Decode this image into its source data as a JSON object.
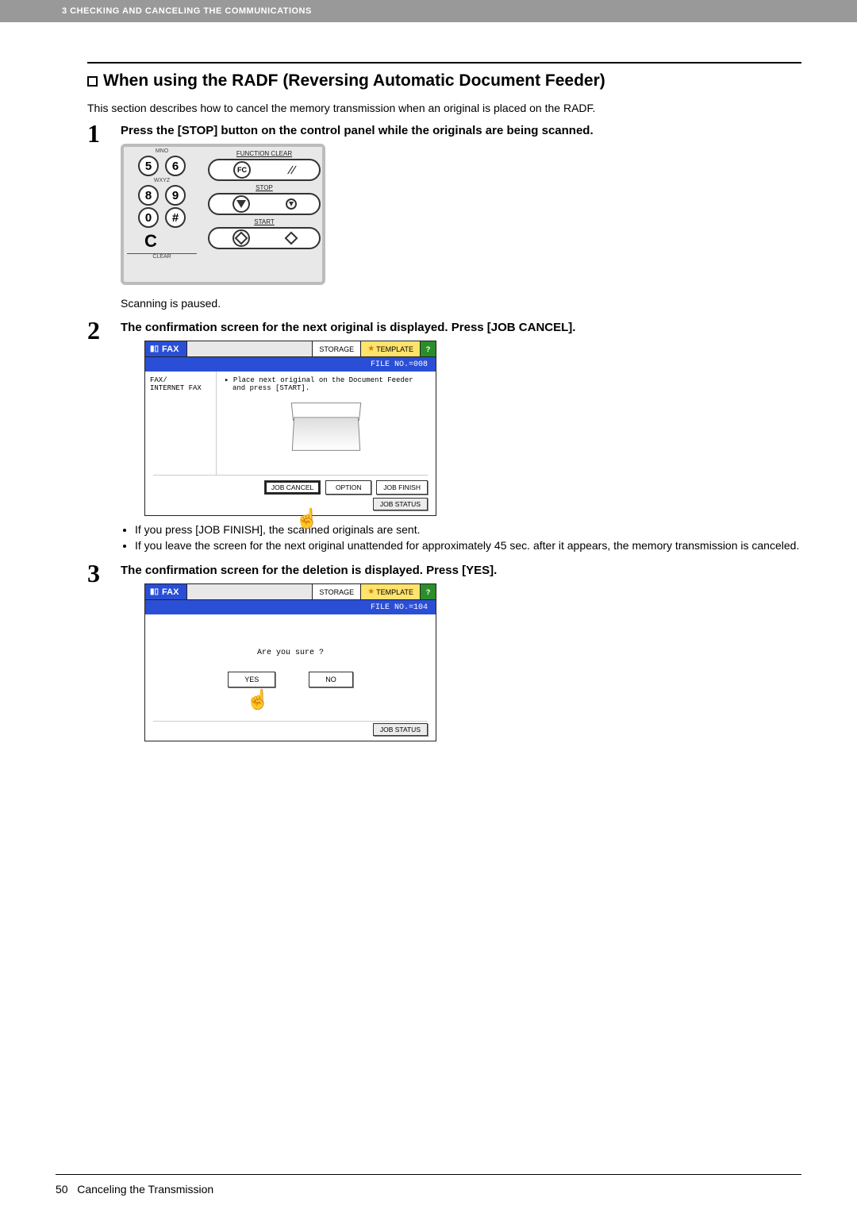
{
  "header": {
    "chapter": "3 CHECKING AND CANCELING THE COMMUNICATIONS"
  },
  "section": {
    "title": "When using the RADF (Reversing Automatic Document Feeder)",
    "intro": "This section describes how to cancel the memory transmission when an original is placed on the RADF."
  },
  "steps": {
    "s1": {
      "num": "1",
      "heading": "Press the [STOP] button on the control panel while the originals are being scanned.",
      "panel": {
        "mno": "MNO",
        "wxyz": "WXYZ",
        "clear": "CLEAR",
        "k5": "5",
        "k6": "6",
        "k8": "8",
        "k9": "9",
        "k0": "0",
        "kh": "#",
        "kc": "C",
        "func_clear": "FUNCTION CLEAR",
        "fc": "FC",
        "stop": "STOP",
        "start": "START"
      },
      "note": "Scanning is paused."
    },
    "s2": {
      "num": "2",
      "heading": "The confirmation screen for the next original is displayed. Press [JOB CANCEL].",
      "lcd": {
        "fax": "FAX",
        "storage": "STORAGE",
        "template": "TEMPLATE",
        "help": "?",
        "file": "FILE NO.=008",
        "side": "FAX/\nINTERNET FAX",
        "msg1": "▸ Place next original on the Document Feeder",
        "msg2": "and press [START].",
        "btn_cancel": "JOB CANCEL",
        "btn_option": "OPTION",
        "btn_finish": "JOB FINISH",
        "status": "JOB STATUS"
      },
      "bullets": {
        "b1": "If you press [JOB FINISH], the scanned originals are sent.",
        "b2": "If you leave the screen for the next original unattended for approximately 45 sec. after it appears, the memory transmission is canceled."
      }
    },
    "s3": {
      "num": "3",
      "heading": "The confirmation screen for the deletion is displayed. Press [YES].",
      "lcd": {
        "fax": "FAX",
        "storage": "STORAGE",
        "template": "TEMPLATE",
        "help": "?",
        "file": "FILE NO.=104",
        "sure": "Are you sure ?",
        "yes": "YES",
        "no": "NO",
        "status": "JOB STATUS"
      }
    }
  },
  "footer": {
    "page": "50",
    "title": "Canceling the Transmission"
  }
}
